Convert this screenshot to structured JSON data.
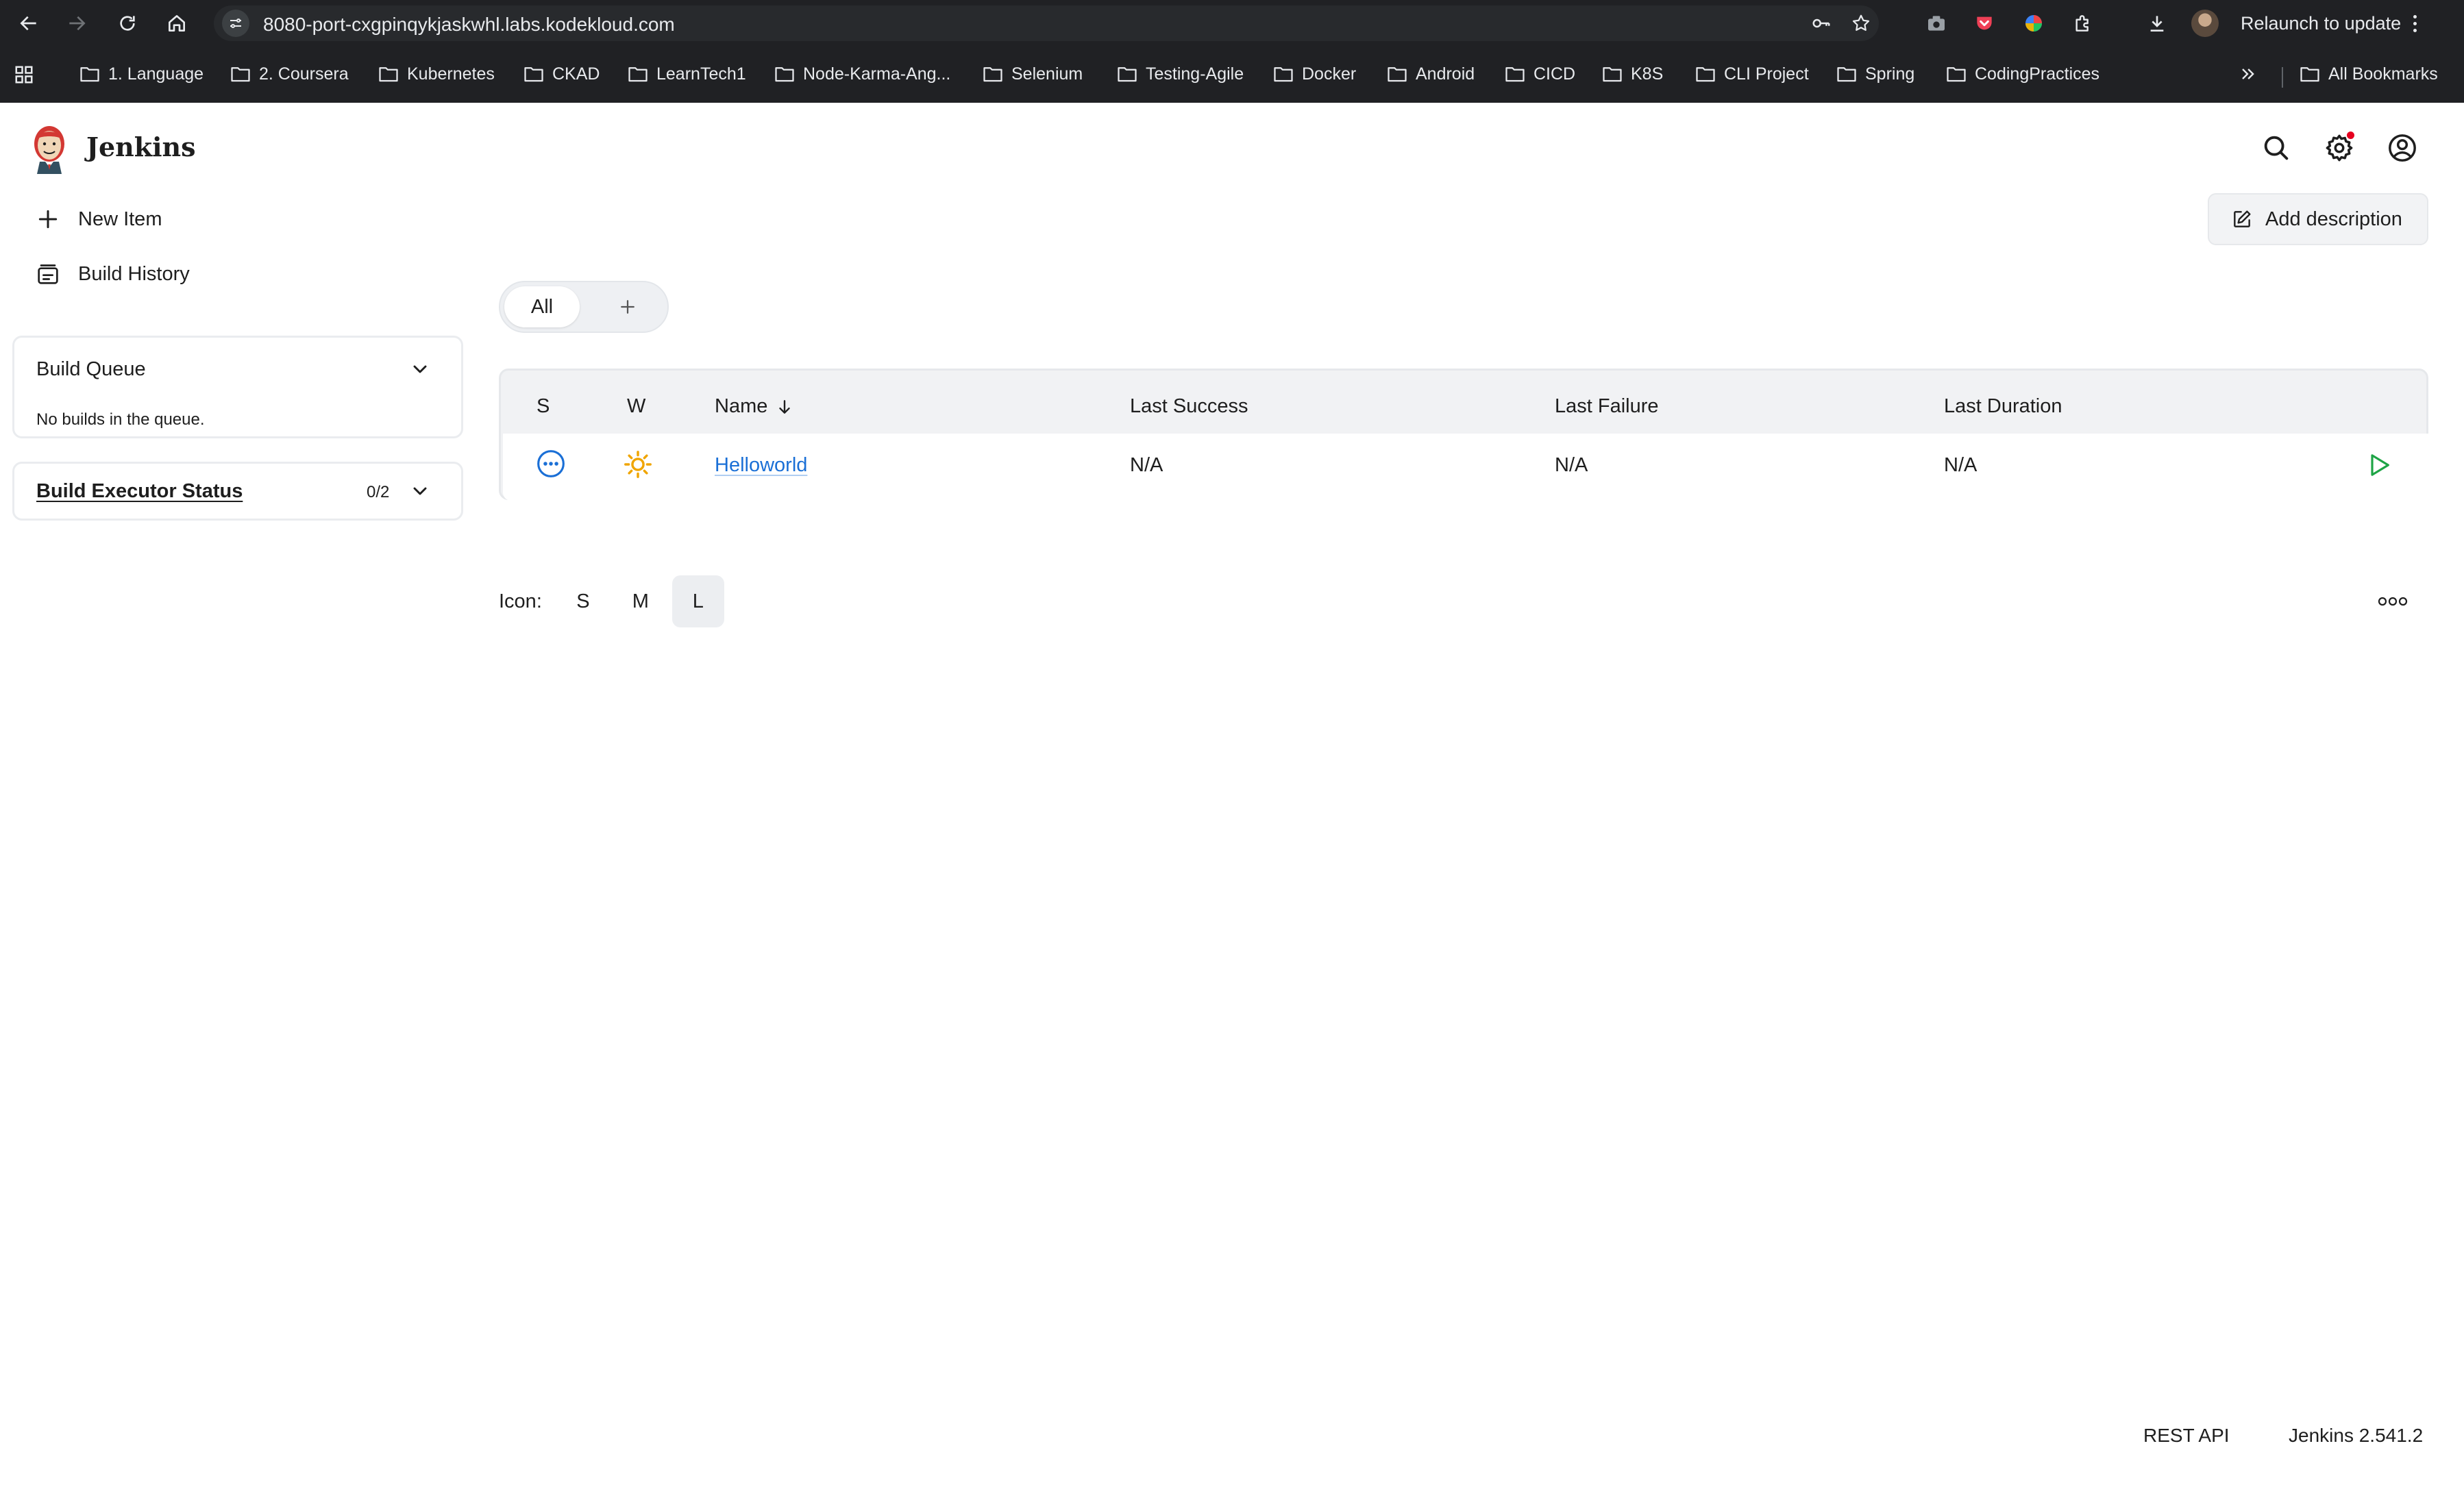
{
  "browser": {
    "url": "8080-port-cxgpinqykjaskwhl.labs.kodekloud.com",
    "relaunch_label": "Relaunch to update",
    "bookmarks": [
      "1. Language",
      "2. Coursera",
      "Kubernetes",
      "CKAD",
      "LearnTech1",
      "Node-Karma-Ang...",
      "Selenium",
      "Testing-Agile",
      "Docker",
      "Android",
      "CICD",
      "K8S",
      "CLI Project",
      "Spring",
      "CodingPractices"
    ],
    "all_bookmarks_label": "All Bookmarks"
  },
  "jenkins": {
    "brand": "Jenkins",
    "sidebar": {
      "new_item": "New Item",
      "build_history": "Build History"
    },
    "build_queue": {
      "title": "Build Queue",
      "empty_text": "No builds in the queue."
    },
    "executors": {
      "title": "Build Executor Status",
      "count": "0/2"
    },
    "add_description": "Add description",
    "view_tabs": {
      "active": "All"
    },
    "table": {
      "headers": {
        "status": "S",
        "weather": "W",
        "name": "Name",
        "last_success": "Last Success",
        "last_failure": "Last Failure",
        "last_duration": "Last Duration"
      },
      "rows": [
        {
          "name": "Helloworld",
          "last_success": "N/A",
          "last_failure": "N/A",
          "last_duration": "N/A",
          "status_icon": "status-not-built-icon",
          "weather_icon": "sunny-icon"
        }
      ]
    },
    "icon_size": {
      "label": "Icon:",
      "options": [
        "S",
        "M",
        "L"
      ],
      "selected": "L"
    },
    "footer": {
      "rest_api": "REST API",
      "version": "Jenkins 2.541.2"
    }
  },
  "colors": {
    "chrome_bg": "#202124",
    "link": "#1a6fd6",
    "weather_sun": "#f0a500",
    "play_green": "#1ea446",
    "notification_dot": "#e6001f"
  }
}
